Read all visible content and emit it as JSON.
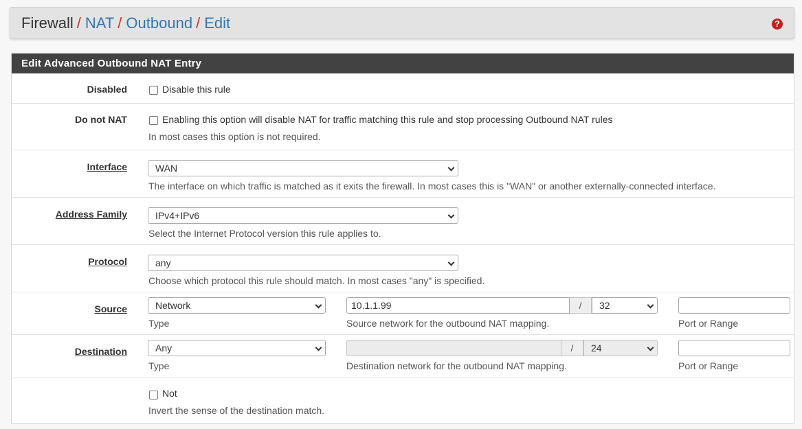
{
  "breadcrumb": {
    "root": "Firewall",
    "sep": "/",
    "items": [
      "NAT",
      "Outbound",
      "Edit"
    ]
  },
  "help_icon": "?",
  "panel": {
    "title": "Edit Advanced Outbound NAT Entry"
  },
  "disabled": {
    "label": "Disabled",
    "checkbox_label": "Disable this rule",
    "checked": false
  },
  "do_not_nat": {
    "label": "Do not NAT",
    "checkbox_label": "Enabling this option will disable NAT for traffic matching this rule and stop processing Outbound NAT rules",
    "help": "In most cases this option is not required.",
    "checked": false
  },
  "interface": {
    "label": "Interface",
    "value": "WAN",
    "help": "The interface on which traffic is matched as it exits the firewall. In most cases this is \"WAN\" or another externally-connected interface."
  },
  "address_family": {
    "label": "Address Family",
    "value": "IPv4+IPv6",
    "help": "Select the Internet Protocol version this rule applies to."
  },
  "protocol": {
    "label": "Protocol",
    "value": "any",
    "help": "Choose which protocol this rule should match. In most cases \"any\" is specified."
  },
  "source": {
    "label": "Source",
    "type_value": "Network",
    "type_help": "Type",
    "address": "10.1.1.99",
    "slash": "/",
    "mask": "32",
    "address_help": "Source network for the outbound NAT mapping.",
    "port": "",
    "port_help": "Port or Range"
  },
  "destination": {
    "label": "Destination",
    "type_value": "Any",
    "type_help": "Type",
    "address": "",
    "slash": "/",
    "mask": "24",
    "address_help": "Destination network for the outbound NAT mapping.",
    "port": "",
    "port_help": "Port or Range"
  },
  "not": {
    "checkbox_label": "Not",
    "help": "Invert the sense of the destination match.",
    "checked": false
  },
  "colors": {
    "link": "#3276b1",
    "separator": "#c0392b",
    "heading_bg": "#424242",
    "help_icon": "#c41e1e"
  }
}
